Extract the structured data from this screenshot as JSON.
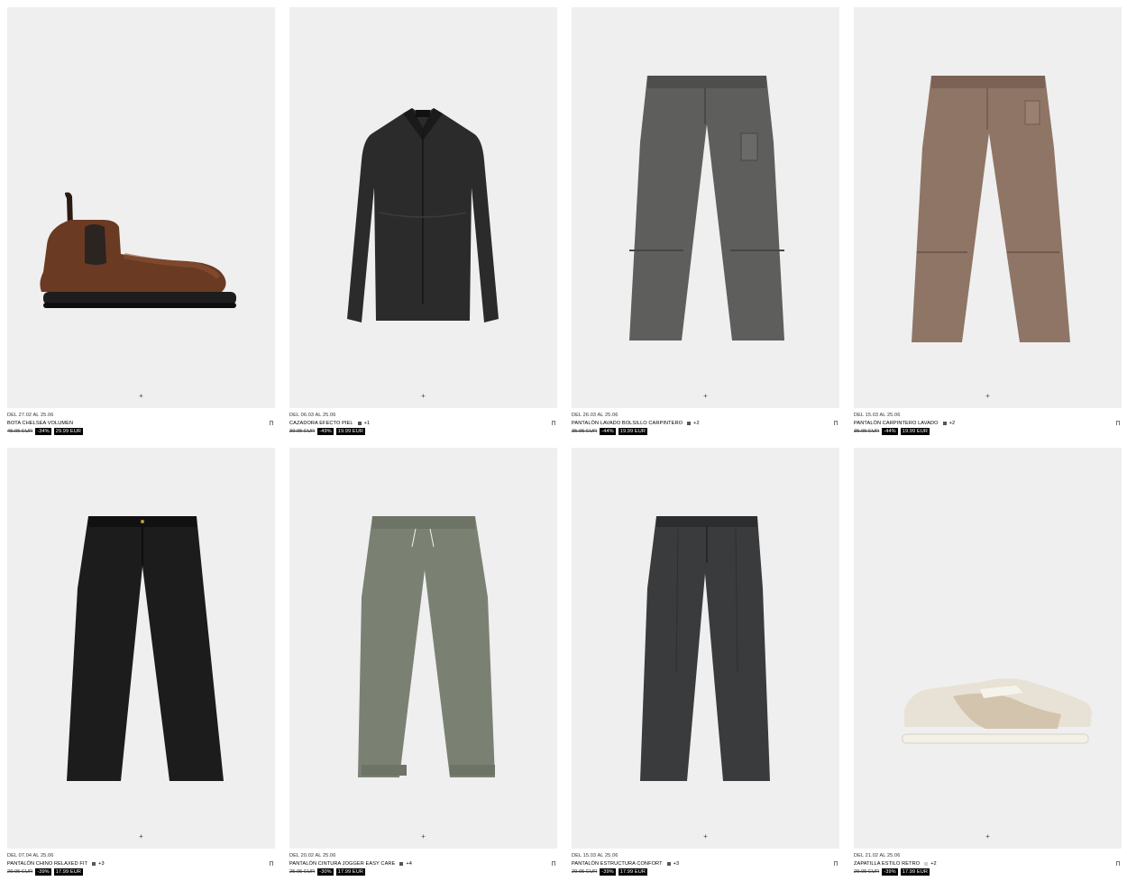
{
  "products": [
    {
      "dates": "DEL 27.02 AL 25.06",
      "name": "BOTA CHELSEA VOLUMEN",
      "colors": "",
      "old_price": "45.95 EUR",
      "discount": "-34%",
      "new_price": "29.99 EUR",
      "image": "chelsea-boot"
    },
    {
      "dates": "DEL 06.03 AL 25.06",
      "name": "CAZADORA EFECTO PIEL",
      "colors": "+1",
      "old_price": "39.95 EUR",
      "discount": "-49%",
      "new_price": "19.99 EUR",
      "image": "leather-jacket"
    },
    {
      "dates": "DEL 26.03 AL 25.06",
      "name": "PANTALÓN LAVADO BOLSILLO CARPINTERO",
      "colors": "+2",
      "old_price": "35.95 EUR",
      "discount": "-44%",
      "new_price": "19.99 EUR",
      "image": "grey-carpenter-pants"
    },
    {
      "dates": "DEL 15.03 AL 25.06",
      "name": "PANTALÓN CARPINTERO LAVADO",
      "colors": "+2",
      "old_price": "35.95 EUR",
      "discount": "-44%",
      "new_price": "19.99 EUR",
      "image": "brown-carpenter-pants"
    },
    {
      "dates": "DEL 07.04 AL 25.06",
      "name": "PANTALÓN CHINO RELAXED FIT",
      "colors": "+3",
      "old_price": "29.95 EUR",
      "discount": "-39%",
      "new_price": "17.99 EUR",
      "image": "black-chino"
    },
    {
      "dates": "DEL 20.02 AL 25.06",
      "name": "PANTALÓN CINTURA JOGGER EASY CARE",
      "colors": "+4",
      "old_price": "25.95 EUR",
      "discount": "-30%",
      "new_price": "17.99 EUR",
      "image": "khaki-jogger"
    },
    {
      "dates": "DEL 15.03 AL 25.06",
      "name": "PANTALÓN ESTRUCTURA CONFORT",
      "colors": "+3",
      "old_price": "29.95 EUR",
      "discount": "-39%",
      "new_price": "17.99 EUR",
      "image": "dark-check-trousers"
    },
    {
      "dates": "DEL 21.02 AL 25.06",
      "name": "ZAPATILLA ESTILO RETRO",
      "colors": "+2",
      "old_price": "29.95 EUR",
      "discount": "-39%",
      "new_price": "17.99 EUR",
      "image": "retro-sneaker"
    }
  ],
  "ui": {
    "add_symbol": "+",
    "bg_color": "#efefef"
  }
}
